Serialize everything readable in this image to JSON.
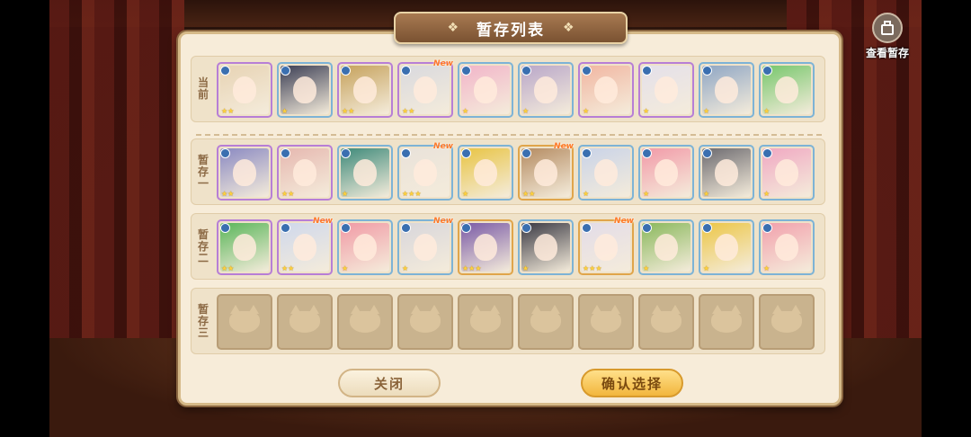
{
  "title": "暂存列表",
  "view_stash_label": "查看暂存",
  "rows": [
    {
      "label": "当前",
      "slots": [
        {
          "color": "#e7d3b4",
          "border": "purple",
          "stars": "★★",
          "new": ""
        },
        {
          "color": "#3c3f55",
          "border": "blue",
          "stars": "★",
          "new": ""
        },
        {
          "color": "#c6a25c",
          "border": "purple",
          "stars": "★★",
          "new": ""
        },
        {
          "color": "#d9d9de",
          "border": "purple",
          "stars": "★★",
          "new": "New"
        },
        {
          "color": "#f2b5c9",
          "border": "blue",
          "stars": "★",
          "new": ""
        },
        {
          "color": "#b9a7c9",
          "border": "blue",
          "stars": "★",
          "new": ""
        },
        {
          "color": "#f1b6a1",
          "border": "purple",
          "stars": "★",
          "new": ""
        },
        {
          "color": "#e4e0ea",
          "border": "purple",
          "stars": "★",
          "new": ""
        },
        {
          "color": "#8fa6c4",
          "border": "blue",
          "stars": "★",
          "new": ""
        },
        {
          "color": "#77c76c",
          "border": "blue",
          "stars": "★",
          "new": ""
        }
      ]
    },
    {
      "label": "暂存一",
      "slots": [
        {
          "color": "#8b8ac2",
          "border": "purple",
          "stars": "★★",
          "new": ""
        },
        {
          "color": "#e6b8b0",
          "border": "purple",
          "stars": "★★",
          "new": ""
        },
        {
          "color": "#3e8a7a",
          "border": "blue",
          "stars": "★",
          "new": ""
        },
        {
          "color": "#e9e2da",
          "border": "blue",
          "stars": "★★★",
          "new": "New"
        },
        {
          "color": "#e8c444",
          "border": "blue",
          "stars": "★",
          "new": ""
        },
        {
          "color": "#b58c62",
          "border": "gold",
          "stars": "★★",
          "new": "New"
        },
        {
          "color": "#c9d3e8",
          "border": "blue",
          "stars": "★",
          "new": ""
        },
        {
          "color": "#f29aa8",
          "border": "blue",
          "stars": "★",
          "new": ""
        },
        {
          "color": "#6d6b70",
          "border": "blue",
          "stars": "★",
          "new": ""
        },
        {
          "color": "#f0a8c2",
          "border": "blue",
          "stars": "★",
          "new": ""
        }
      ]
    },
    {
      "label": "暂存二",
      "slots": [
        {
          "color": "#5bb65a",
          "border": "purple",
          "stars": "★★",
          "new": ""
        },
        {
          "color": "#cfd8ec",
          "border": "purple",
          "stars": "★★",
          "new": "New"
        },
        {
          "color": "#f19aa5",
          "border": "blue",
          "stars": "★",
          "new": ""
        },
        {
          "color": "#d8d6db",
          "border": "blue",
          "stars": "★",
          "new": "New"
        },
        {
          "color": "#7a5aa6",
          "border": "gold",
          "stars": "★★★",
          "new": ""
        },
        {
          "color": "#3a3943",
          "border": "blue",
          "stars": "★",
          "new": ""
        },
        {
          "color": "#e3dce8",
          "border": "gold",
          "stars": "★★★",
          "new": "New"
        },
        {
          "color": "#8ab85c",
          "border": "blue",
          "stars": "★",
          "new": ""
        },
        {
          "color": "#ecc646",
          "border": "blue",
          "stars": "★",
          "new": ""
        },
        {
          "color": "#f2a0ac",
          "border": "blue",
          "stars": "★",
          "new": ""
        }
      ]
    },
    {
      "label": "暂存三",
      "slots": [
        {
          "empty": true
        },
        {
          "empty": true
        },
        {
          "empty": true
        },
        {
          "empty": true
        },
        {
          "empty": true
        },
        {
          "empty": true
        },
        {
          "empty": true
        },
        {
          "empty": true
        },
        {
          "empty": true
        },
        {
          "empty": true
        }
      ]
    }
  ],
  "buttons": {
    "close": "关闭",
    "confirm": "确认选择"
  }
}
